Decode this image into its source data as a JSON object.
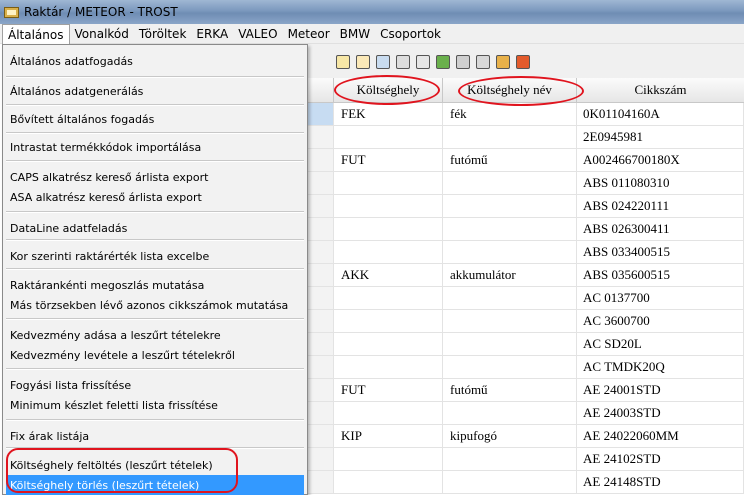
{
  "window": {
    "title": "Raktár / METEOR - TROST"
  },
  "menubar": {
    "items": [
      "Általános",
      "Vonalkód",
      "Töröltek",
      "ERKA",
      "VALEO",
      "Meteor",
      "BMW",
      "Csoportok"
    ]
  },
  "dropdown": {
    "items": [
      "Általános adatfogadás",
      "Általános adatgenerálás",
      "Bővített általános fogadás",
      "Intrastat termékkódok importálása",
      "CAPS alkatrész kereső árlista export",
      "ASA alkatrész kereső árlista export",
      "DataLine adatfeladás",
      "Kor szerinti raktárérték lista excelbe",
      "Raktárankénti megoszlás mutatása",
      "Más törzsekben lévő azonos cikkszámok mutatása",
      "Kedvezmény adása a leszűrt tételekre",
      "Kedvezmény levétele a leszűrt tételekről",
      "Fogyási lista frissítése",
      "Minimum készlet feletti lista frissítése",
      "Fix árak listája",
      "Költséghely feltöltés (leszűrt tételek)",
      "Költséghely törlés (leszűrt tételek)"
    ],
    "highlighted_index": 16
  },
  "grid": {
    "columns": [
      "Költséghely",
      "Költséghely név",
      "Cikkszám"
    ],
    "rows": [
      [
        "FEK",
        "fék",
        "0K01104160A"
      ],
      [
        "",
        "",
        "2E0945981"
      ],
      [
        "FUT",
        "futómű",
        "A002466700180X"
      ],
      [
        "",
        "",
        "ABS 011080310"
      ],
      [
        "",
        "",
        "ABS 024220111"
      ],
      [
        "",
        "",
        "ABS 026300411"
      ],
      [
        "",
        "",
        "ABS 033400515"
      ],
      [
        "AKK",
        "akkumulátor",
        "ABS 035600515"
      ],
      [
        "",
        "",
        "AC 0137700"
      ],
      [
        "",
        "",
        "AC 3600700"
      ],
      [
        "",
        "",
        "AC SD20L"
      ],
      [
        "",
        "",
        "AC TMDK20Q"
      ],
      [
        "FUT",
        "futómű",
        "AE 24001STD"
      ],
      [
        "",
        "",
        "AE 24003STD"
      ],
      [
        "KIP",
        "kipufogó",
        "AE 24022060MM"
      ],
      [
        "",
        "",
        "AE 24102STD"
      ],
      [
        "",
        "",
        "AE 24148STD"
      ]
    ]
  },
  "colors": {
    "highlight": "#3399ff",
    "annotation": "#e0141e"
  },
  "icons": [
    "app-icon",
    "edit-icon",
    "new-icon",
    "copy-icon",
    "sum-icon",
    "print-icon",
    "excel-icon",
    "printer-icon",
    "tools-icon",
    "filter-icon",
    "close-icon"
  ]
}
